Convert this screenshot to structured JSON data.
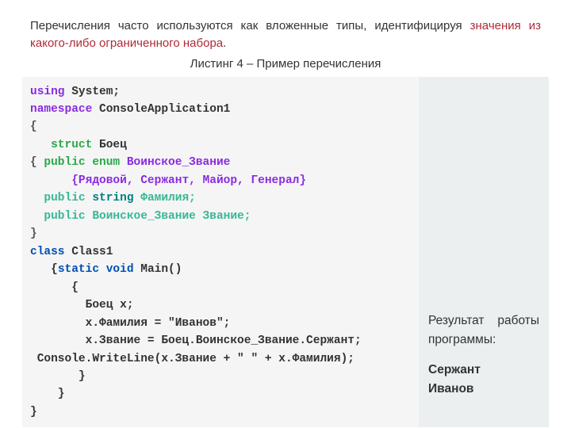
{
  "intro": {
    "pre": "Перечисления часто используются как вложенные типы, идентифицируя ",
    "hl": "значения из какого-либо ограниченного набора",
    "post": "."
  },
  "caption": "Листинг 4 – Пример перечисления",
  "code": {
    "l1a": "using",
    "l1b": " System;",
    "l2a": "namespace",
    "l2b": " ConsoleApplication1",
    "l3": "{",
    "l4a": "   struct ",
    "l4b": "Боец",
    "l5a": "{ ",
    "l5b": "public ",
    "l5c": "enum ",
    "l5d": "Воинское_Звание",
    "l6a": "      {",
    "l6b": "Рядовой, Сержант, Майор, Генерал",
    "l6c": "}",
    "l7a": "  public ",
    "l7b": "string ",
    "l7c": "Фамилия;",
    "l8a": "  public ",
    "l8b": "Воинское_Звание Звание;",
    "l9": "}",
    "l10a": "class",
    "l10b": " Class1",
    "l11a": "   {",
    "l11b": "static",
    "l11c": " ",
    "l11d": "void",
    "l11e": " Main()",
    "l12": "      {",
    "l13": "        Боец x;",
    "l14": "        x.Фамилия = \"Иванов\";",
    "l15": "        x.Звание = Боец.Воинское_Звание.Сержант;",
    "l16": " Console.WriteLine(x.Звание + \" \" + x.Фамилия);",
    "l17": "       }",
    "l18": "    }",
    "l19": "}"
  },
  "output": {
    "label": "Результат работы программы:",
    "line1": "Сержант",
    "line2": "Иванов"
  }
}
